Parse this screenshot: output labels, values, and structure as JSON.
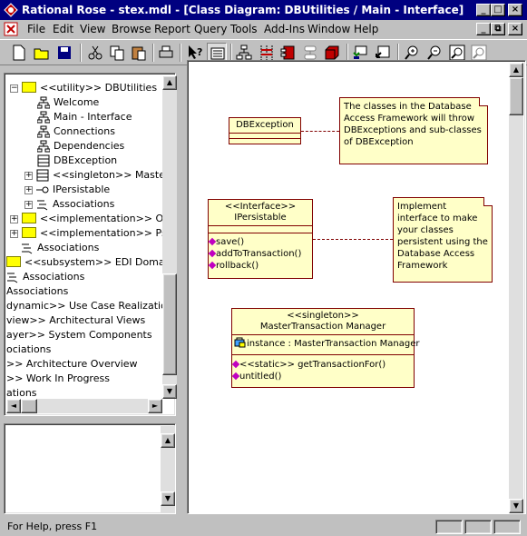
{
  "window": {
    "title": "Rational Rose - stex.mdl - [Class Diagram: DBUtilities / Main - Interface]"
  },
  "menu": [
    "File",
    "Edit",
    "View",
    "Browse",
    "Report",
    "Query",
    "Tools",
    "Add-Ins",
    "Window",
    "Help"
  ],
  "browser": {
    "items": [
      "<<utility>> DBUtilities",
      "Welcome",
      "Main - Interface",
      "Connections",
      "Dependencies",
      "DBException",
      "<<singleton>> Master",
      "IPersistable",
      "Associations",
      "<<implementation>> Oracl",
      "<<implementation>> Psyb",
      "Associations",
      "<<subsystem>> EDI Domain",
      "Associations",
      "Associations",
      "dynamic>> Use Case Realizations",
      "view>> Architectural Views",
      "ayer>> System Components",
      "ociations",
      ">> Architecture Overview",
      ">> Work In Progress",
      "ations"
    ]
  },
  "diagram": {
    "dbexception": {
      "name": "DBException"
    },
    "note1": {
      "lines": [
        "The classes in the Database",
        "Access Framework will throw",
        "DBExceptions and sub-classes",
        "of DBException"
      ]
    },
    "ipersistable": {
      "stereotype": "<<Interface>>",
      "name": "IPersistable",
      "ops": [
        "save()",
        "addToTransaction()",
        "rollback()"
      ]
    },
    "note2": {
      "lines": [
        "Implement",
        "interface to make",
        "your classes",
        "persistent using the",
        "Database Access",
        "Framework"
      ]
    },
    "master": {
      "stereotype": "<<singleton>>",
      "name": "MasterTransaction Manager",
      "attr": "instance : MasterTransaction Manager",
      "ops": [
        "<<static>> getTransactionFor()",
        "untitled()"
      ]
    }
  },
  "status": {
    "text": "For Help, press F1"
  },
  "colors": {
    "titlebar": "#000080",
    "class_fill": "#ffffc8",
    "class_border": "#800000",
    "folder": "#ffff00"
  }
}
